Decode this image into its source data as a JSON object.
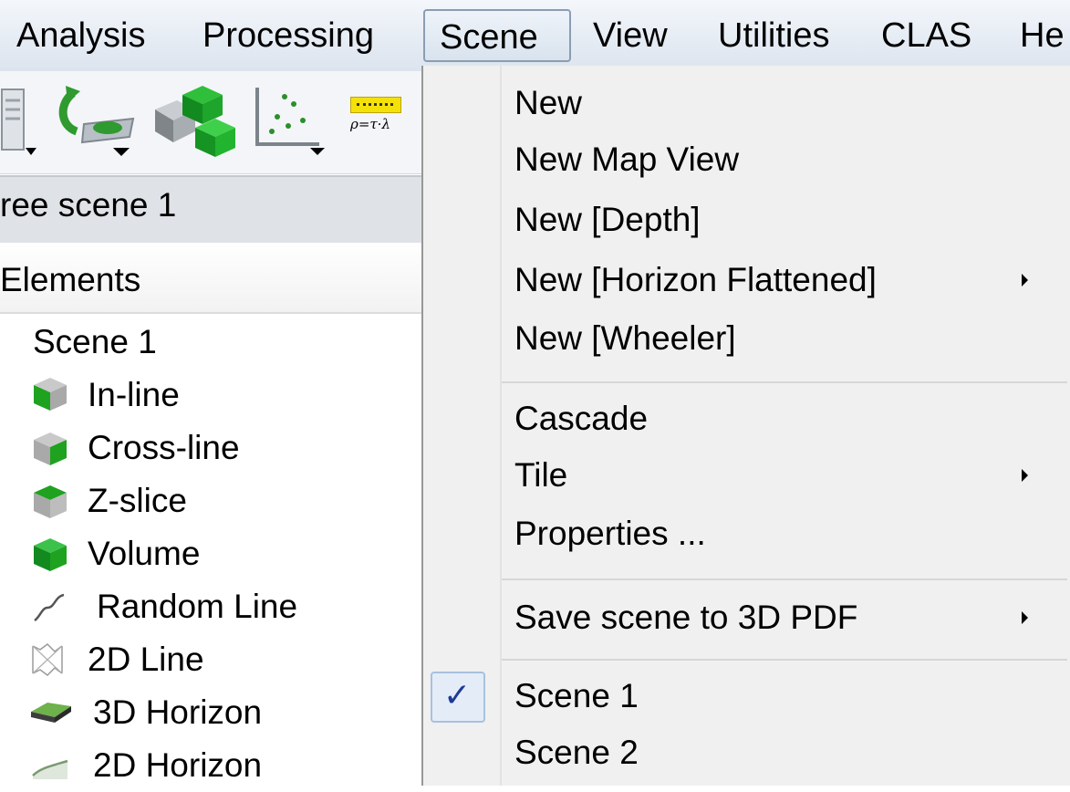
{
  "menubar": {
    "items": [
      {
        "label": "Analysis"
      },
      {
        "label": "Processing"
      },
      {
        "label": "Scene"
      },
      {
        "label": "View"
      },
      {
        "label": "Utilities"
      },
      {
        "label": "CLAS"
      },
      {
        "label": "He"
      }
    ]
  },
  "toolbar": {
    "icons": [
      "panel-icon",
      "export-icon",
      "3d-blocks-icon",
      "scatter-plot-icon",
      "formula-icon"
    ],
    "formula_text": "ρ=τ·λ"
  },
  "scene_tab": {
    "label": "ree scene 1"
  },
  "elements_panel": {
    "header": "Elements",
    "root": "Scene 1",
    "items": [
      {
        "label": "In-line",
        "icon": "inline-cube-icon"
      },
      {
        "label": "Cross-line",
        "icon": "crossline-cube-icon"
      },
      {
        "label": "Z-slice",
        "icon": "zslice-cube-icon"
      },
      {
        "label": "Volume",
        "icon": "volume-cube-icon"
      },
      {
        "label": "Random Line",
        "icon": "random-line-icon"
      },
      {
        "label": "2D Line",
        "icon": "2d-line-icon"
      },
      {
        "label": "3D Horizon",
        "icon": "3d-horizon-icon"
      },
      {
        "label": "2D Horizon",
        "icon": "2d-horizon-icon"
      }
    ]
  },
  "scene_menu": {
    "items": [
      {
        "label": "New"
      },
      {
        "label": "New Map View"
      },
      {
        "label": "New [Depth]"
      },
      {
        "label": "New [Horizon Flattened]",
        "submenu": true
      },
      {
        "label": "New [Wheeler]"
      },
      {
        "label": "Cascade"
      },
      {
        "label": "Tile",
        "submenu": true
      },
      {
        "label": "Properties ..."
      },
      {
        "label": "Save scene to 3D PDF",
        "submenu": true
      },
      {
        "label": "Scene 1",
        "checked": true
      },
      {
        "label": "Scene 2"
      }
    ],
    "check_glyph": "✓"
  },
  "colors": {
    "menu_bg": "#f0f0f0",
    "cube_green": "#1fa21f",
    "cube_gray": "#a9a9a9",
    "check_blue": "#1d3a96"
  }
}
